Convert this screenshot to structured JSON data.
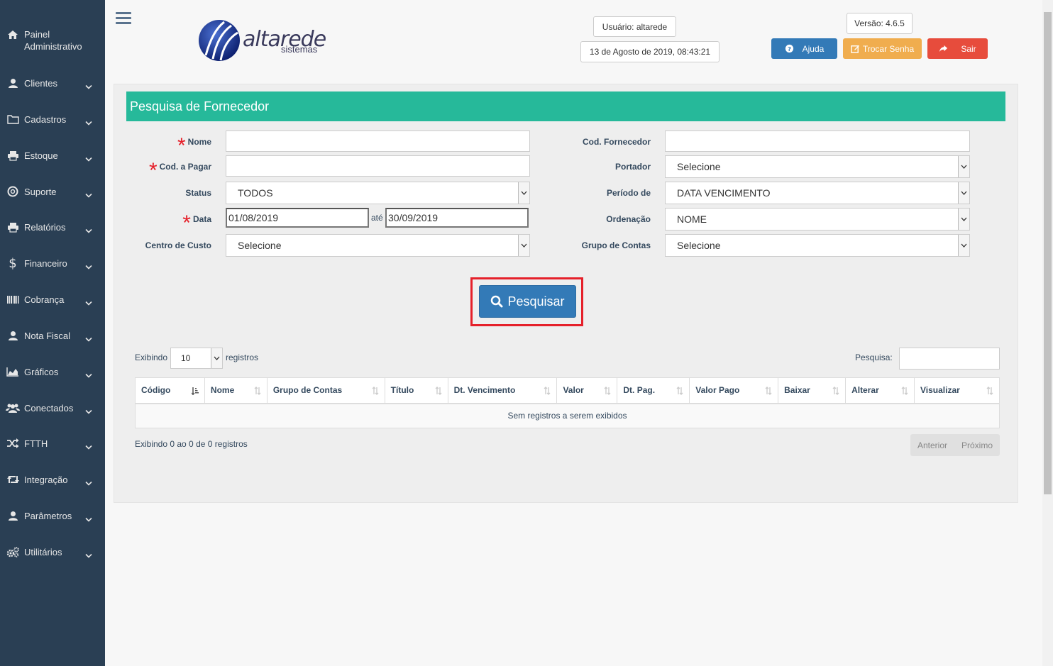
{
  "sidebar": {
    "painel": "Painel Administrativo",
    "items": [
      {
        "label": "Clientes",
        "icon": "user-icon"
      },
      {
        "label": "Cadastros",
        "icon": "folder-icon"
      },
      {
        "label": "Estoque",
        "icon": "print-icon"
      },
      {
        "label": "Suporte",
        "icon": "life-ring-icon"
      },
      {
        "label": "Relatórios",
        "icon": "print-icon"
      },
      {
        "label": "Financeiro",
        "icon": "dollar-icon"
      },
      {
        "label": "Cobrança",
        "icon": "barcode-icon"
      },
      {
        "label": "Nota Fiscal",
        "icon": "user-icon"
      },
      {
        "label": "Gráficos",
        "icon": "area-chart-icon"
      },
      {
        "label": "Conectados",
        "icon": "users-icon"
      },
      {
        "label": "FTTH",
        "icon": "random-icon"
      },
      {
        "label": "Integração",
        "icon": "retweet-icon"
      },
      {
        "label": "Parâmetros",
        "icon": "user-icon"
      },
      {
        "label": "Utilitários",
        "icon": "cogs-icon"
      }
    ]
  },
  "header": {
    "logo_text": "altarede",
    "logo_sub": "sistemas",
    "usuario": "Usuário: altarede",
    "datetime": "13 de Agosto de 2019, 08:43:21",
    "versao": "Versão: 4.6.5",
    "ajuda": "Ajuda",
    "trocar_senha": "Trocar Senha",
    "sair": "Sair"
  },
  "form": {
    "title": "Pesquisa de Fornecedor",
    "nome_label": "Nome",
    "cod_pagar_label": "Cod. a Pagar",
    "status_label": "Status",
    "status_value": "TODOS",
    "data_label": "Data",
    "data_inicio": "01/08/2019",
    "ate": "até",
    "data_fim": "30/09/2019",
    "centro_custo_label": "Centro de Custo",
    "centro_custo_value": "Selecione",
    "cod_fornecedor_label": "Cod. Fornecedor",
    "portador_label": "Portador",
    "portador_value": "Selecione",
    "periodo_label": "Período de",
    "periodo_value": "DATA VENCIMENTO",
    "ordenacao_label": "Ordenação",
    "ordenacao_value": "NOME",
    "grupo_contas_label": "Grupo de Contas",
    "grupo_contas_value": "Selecione",
    "pesquisar": "Pesquisar"
  },
  "table": {
    "exibindo": "Exibindo",
    "page_size": "10",
    "registros": "registros",
    "pesquisa_label": "Pesquisa:",
    "columns": [
      "Código",
      "Nome",
      "Grupo de Contas",
      "Título",
      "Dt. Vencimento",
      "Valor",
      "Dt. Pag.",
      "Valor Pago",
      "Baixar",
      "Alterar",
      "Visualizar"
    ],
    "empty": "Sem registros a serem exibidos",
    "info": "Exibindo 0 ao 0 de 0 registros",
    "anterior": "Anterior",
    "proximo": "Próximo"
  },
  "colors": {
    "sidebar": "#2a3f54",
    "title_bar": "#26b99a",
    "primary": "#337ab7",
    "warning": "#f0ad4e",
    "danger": "#e74c3c",
    "highlight": "#e5202a"
  }
}
